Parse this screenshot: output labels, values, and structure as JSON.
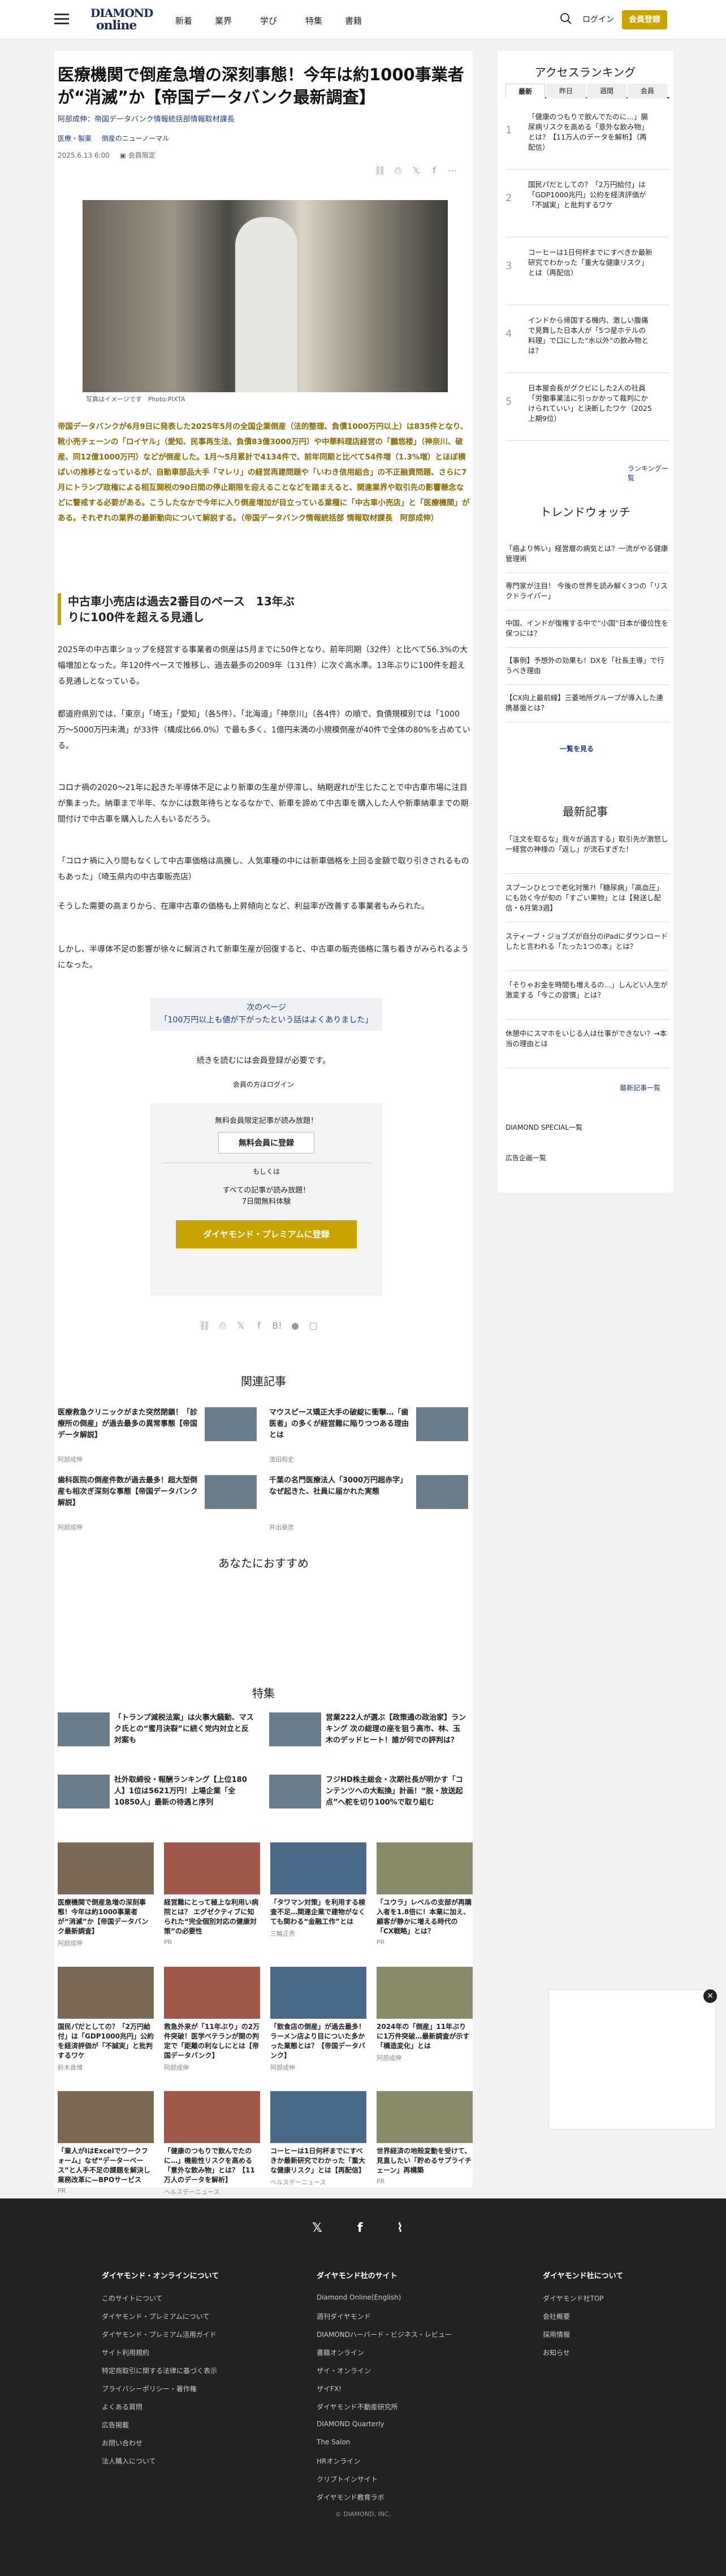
{
  "header": {
    "logo_line1": "DIAMOND",
    "logo_line2": "online",
    "nav": [
      "新着",
      "業界",
      "学び",
      "特集",
      "書籍"
    ],
    "login": "ログイン",
    "register": "会員登録"
  },
  "article": {
    "title": "医療機関で倒産急増の深刻事態！今年は約1000事業者が“消滅”か【帝国データバンク最新調査】",
    "byline": "阿部成伸：帝国データバンク情報統括部情報取材課長",
    "tags": [
      "医療・製薬",
      "倒産のニューノーマル"
    ],
    "date": "2025.6.13 6:00",
    "save": "会員限定",
    "caption": "写真はイメージです　Photo:PIXTA",
    "lead": "帝国データバンクが6月9日に発表した2025年5月の全国企業倒産（法的整理、負債1000万円以上）は835件となり、靴小売チェーンの「ロイヤル」（愛知、民事再生法、負債83億3000万円）や中華料理店経営の「鵬悠楼」（神奈川、破産、同12億1000万円）などが倒産した。1月〜5月累計で4134件で、前年同期と比べて54件増（1.3%増）とほぼ横ばいの推移となっているが、自動車部品大手「マレリ」の経営再建問題や「いわき信用組合」の不正融資問題、さらに7月にトランプ政権による相互関税の90日間の停止期限を迎えることなどを踏まえると、関連業界や取引先の影響懸念などに警戒する必要がある。こうしたなかで今年に入り倒産増加が目立っている業種に「中古車小売店」と「医療機関」がある。それぞれの業界の最新動向について解説する。（帝国データバンク情報統括部 情報取材課長　阿部成伸）",
    "h2": "中古車小売店は過去2番目のペース　13年ぶりに100件を超える見通し",
    "paragraphs": [
      "2025年の中古車ショップを経営する事業者の倒産は5月までに50件となり、前年同期（32件）と比べて56.3%の大幅増加となった。年120件ペースで推移し、過去最多の2009年（131件）に次ぐ高水準。13年ぶりに100件を超える見通しとなっている。",
      "都道府県別では、「東京」「埼玉」「愛知」（各5件）、「北海道」「神奈川」（各4件）の順で、負債規模別では「1000万〜5000万円未満」が33件（構成比66.0%）で最も多く、1億円未満の小規模倒産が40件で全体の80%を占めている。",
      "コロナ禍の2020〜21年に起きた半導体不足により新車の生産が停滞し、納期遅れが生じたことで中古車市場に注目が集まった。納車まで半年、なかには数年待ちとなるなかで、新車を諦めて中古車を購入した人や新車納車までの期間付けで中古車を購入した人もいるだろう。",
      "「コロナ禍に入り間もなくして中古車価格は高騰し、人気車種の中には新車価格を上回る金額で取り引きされるものもあった」（埼玉県内の中古車販売店）",
      "そうした需要の高まりから、在庫中古車の価格も上昇傾向となど、利益率が改善する事業者もみられた。",
      "しかし、半導体不足の影響が徐々に解消されて新車生産が回復すると、中古車の販売価格に落ち着きがみられるようになった。"
    ],
    "next_label": "次のページ",
    "next_title": "「100万円以上も値が下がったという話はよくありました」",
    "continue": "続きを読むには会員登録が必要です。",
    "member_login": "会員の方はログイン",
    "gate": {
      "free_text": "無料会員限定記事が読み放題！",
      "free_btn": "無料会員に登録",
      "or": "もしくは",
      "premium_text": "すべての記事が読み放題！",
      "trial": "7日間無料体験",
      "premium_btn": "ダイヤモンド・プレミアムに登録"
    }
  },
  "related": {
    "title": "関連記事",
    "items": [
      {
        "t": "医療救急クリニックがまた突然閉鎖！「診療所の倒産」が過去最多の異常事態【帝国データ解説】",
        "a": "阿部成伸"
      },
      {
        "t": "マウスピース矯正大手の破綻に衝撃…「歯医者」の多くが経営難に陥りつつある理由とは",
        "a": "濱田和史"
      },
      {
        "t": "歯科医院の倒産件数が過去最多！超大型倒産も相次ぎ深刻な事態【帝国データバンク解説】",
        "a": "阿部成伸"
      },
      {
        "t": "千葉の名門医療法人「3000万円超赤字」なぜ起きた、社員に届かれた実態",
        "a": "井出豪彦"
      }
    ]
  },
  "recommend": {
    "title": "あなたにおすすめ"
  },
  "special": {
    "title": "特集",
    "items": [
      {
        "t": "「トランプ減税法案」は火事大騒動、マスク氏との“蜜月決裂”に続く党内対立と反対案も"
      },
      {
        "t": "営業222人が選ぶ【政策通の政治家】ランキング 次の総理の座を狙う高市、林、玉木のデッドヒート！誰が何での評判は？"
      },
      {
        "t": "社外取締役・報酬ランキング【上位180人】1位は5621万円！上場企業「全10850人」最新の待遇と序列"
      },
      {
        "t": "フジHD株主総会・次期社長が明かす「コンテンツへの大転換」計画！“脱・放送起点”へ舵を切り100%で取り組む"
      }
    ],
    "grid": [
      {
        "t": "医療機関で倒産急増の深刻事態！今年は約1000事業者が“消滅”か【帝国データバンク最新調査】",
        "a": "阿部成伸"
      },
      {
        "t": "経営難にとって極上な利用い病院とは？ エグゼクティブに知られた“完全個別対応の健康対策”の必要性",
        "a": "PR"
      },
      {
        "t": "「タワマン対策」を利用する検査不足…関連企業で建物がなくても関わる“金融工作”とは",
        "a": "三輪正秀"
      },
      {
        "t": "「ユウラ」レベルの支部が再購入者を1.8倍に！本業に加え、顧客が静かに増える時代の「CX戦略」とは？",
        "a": "PR"
      },
      {
        "t": "国民パだとしての？「2万円給付」は「GDP1000兆円」公約を経済評価が「不誠実」と批判するワケ",
        "a": "鈴木貴博"
      },
      {
        "t": "救急外来が「11年ぶり」の2万件突破！医学ベテランが関の判定で「距離の利なしにとは【帝国データバンク】",
        "a": "阿部成伸"
      },
      {
        "t": "「飲食店の倒産」が過去最多！ラーメン店より目についた多かった業態とは？【帝国データバンク】",
        "a": "阿部成伸"
      },
      {
        "t": "2024年の「倒産」11年ぶりに1万件突破…最新調査が示す「構造変化」とは",
        "a": "阿部成伸"
      },
      {
        "t": "「業人がIはExcelでワークフォーム」なぜ“データーベース”と人手不足の課題を解決し業務改革に—BPOサービス",
        "a": "PR"
      },
      {
        "t": "「健康のつもりで飲んでたのに…」機能性リスクを高める「意外な飲み物」とは？【11万人のデータを解析】",
        "a": "ヘルスデーニュース"
      },
      {
        "t": "コーヒーは1日何杯までにすべきか最新研究でわかった「重大な健康リスク」とは【再配信】",
        "a": "ヘルスデーニュース"
      },
      {
        "t": "世界経済の地殻変動を受けて、見直したい「貯めるサプライチェーン」再構築",
        "a": "PR"
      }
    ]
  },
  "sidebar": {
    "ranking_title": "アクセスランキング",
    "tabs": [
      "最新",
      "昨日",
      "週間",
      "会員"
    ],
    "ranking": [
      {
        "n": "1",
        "t": "「健康のつもりで飲んでたのに…」腸尿病リスクを高める「意外な飲み物」とは？【11万人のデータを解析】（再配信）"
      },
      {
        "n": "2",
        "t": "国民パだとしての？「2万円給付」は「GDP1000兆円」公約を経済評価が「不誠実」と批判するワケ"
      },
      {
        "n": "3",
        "t": "コーヒーは1日何杯までにすべきか最新研究でわかった「重大な健康リスク」とは（再配信）"
      },
      {
        "n": "4",
        "t": "インドから帰国する機内、激しい腹痛で見舞した日本人が「5つ星ホテルの料理」で口にした“水以外”の飲み物とは？"
      },
      {
        "n": "5",
        "t": "日本屋会長がグクビにした2人の社員「労働事業法に引っかかって裁判にかけられていい」と決断したワケ（2025上期9位）"
      }
    ],
    "ranking_more": "ランキング一覧",
    "trend_title": "トレンドウォッチ",
    "trends": [
      "「癌より怖い」経営層の病気とは？一流がやる健康管理術",
      "専門家が注目！ 今後の世界を読み解く3つの「リスクドライバー」",
      "中国、インドが復権する中で“小国”日本が優位性を保つには？",
      "【事例】予想外の効果も！DXを「社長主導」で行うべき理由",
      "【CX向上最前線】三菱地所グループが導入した連携基盤とは？"
    ],
    "trend_more": "一覧を見る",
    "latest_title": "最新記事",
    "latest": [
      "「注文を取るな」我々が過言する」取引先が激怒し一経営の神様の「返し」が流石すぎた！",
      "スプーンひとつで老化対策?!「糖尿病」「高血圧」にも効く今が旬の「すごい果物」とは【発送し配信・6月第3週】",
      "スティーブ・ジョブズが自分のiPadにダウンロードしたと言われる「たった1つの本」とは？",
      "「そりゃお金を時間も増えるの…」しんどい人生が激変する「今この習慣」とは？",
      "休憩中にスマホをいじる人は仕事ができない？→本当の理由とは"
    ],
    "latest_more": "最新記事一覧",
    "special_link": "DIAMOND SPECIAL一覧",
    "ad_link": "広告企画一覧"
  },
  "footer": {
    "col1_title": "ダイヤモンド・オンラインについて",
    "col1": [
      "このサイトについて",
      "ダイヤモンド・プレミアムについて",
      "ダイヤモンド・プレミアム活用ガイド",
      "サイト利用規約",
      "特定商取引に関する法律に基づく表示",
      "プライバシーポリシー・著作権",
      "よくある質問",
      "広告掲載",
      "お問い合わせ",
      "法人購入について"
    ],
    "col2_title": "ダイヤモンド社のサイト",
    "col2": [
      "Diamond Online(English)",
      "週刊ダイヤモンド",
      "DIAMONDハーバード・ビジネス・レビュー",
      "書籍オンライン",
      "ザイ・オンライン",
      "ザイFX!",
      "ダイヤモンド不動産研究所",
      "DIAMOND Quarterly",
      "The Salon",
      "HRオンライン",
      "クリプトインサイト",
      "ダイヤモンド教育ラボ"
    ],
    "col3_title": "ダイヤモンド社について",
    "col3": [
      "ダイヤモンド社TOP",
      "会社概要",
      "採用情報",
      "お知らせ"
    ],
    "copyright": "© DIAMOND, INC."
  }
}
